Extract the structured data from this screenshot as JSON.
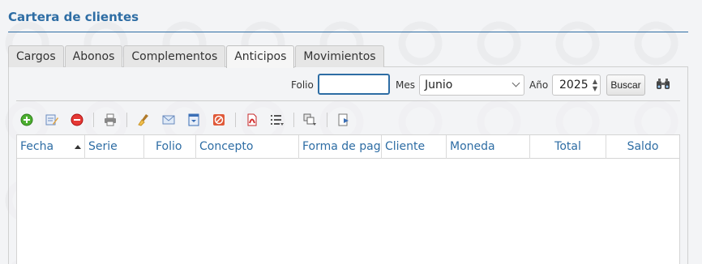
{
  "header": {
    "title": "Cartera de clientes"
  },
  "tabs": [
    {
      "label": "Cargos",
      "active": false
    },
    {
      "label": "Abonos",
      "active": false
    },
    {
      "label": "Complementos",
      "active": false
    },
    {
      "label": "Anticipos",
      "active": true
    },
    {
      "label": "Movimientos",
      "active": false
    }
  ],
  "filters": {
    "folio_label": "Folio",
    "folio_value": "",
    "mes_label": "Mes",
    "mes_value": "Junio",
    "anio_label": "Año",
    "anio_value": "2025",
    "buscar_label": "Buscar"
  },
  "toolbar": {
    "icons": [
      "add-icon",
      "edit-icon",
      "delete-icon",
      "print-icon",
      "clean-icon",
      "email-icon",
      "download-icon",
      "cancel-icon",
      "pdf-icon",
      "list-icon",
      "copy-icon",
      "export-icon"
    ]
  },
  "grid": {
    "columns": [
      "Fecha",
      "Serie",
      "Folio",
      "Concepto",
      "Forma de pag",
      "Cliente",
      "Moneda",
      "Total",
      "Saldo"
    ],
    "rows": []
  },
  "colors": {
    "accent": "#2e6da4"
  }
}
